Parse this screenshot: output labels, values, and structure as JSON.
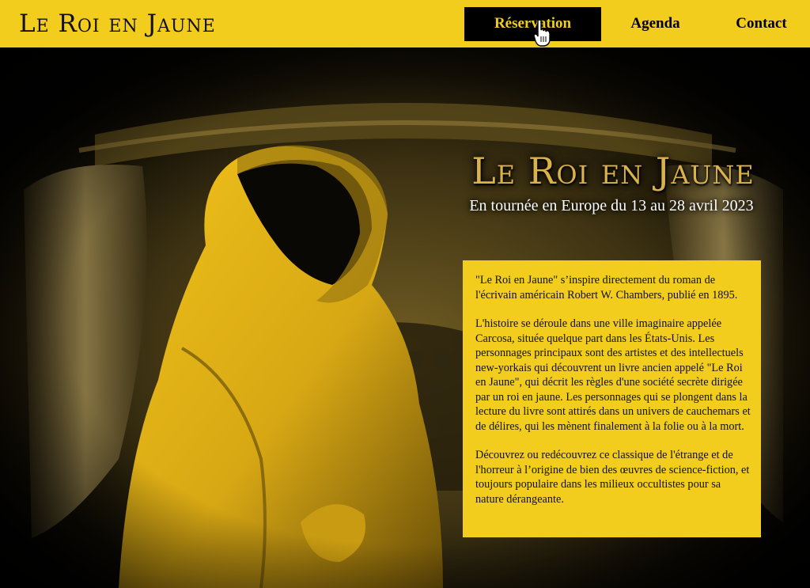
{
  "header": {
    "logo": "Le Roi en Jaune",
    "nav": [
      {
        "label": "Réservation"
      },
      {
        "label": "Agenda"
      },
      {
        "label": "Contact"
      }
    ]
  },
  "hero": {
    "title": "Le Roi en Jaune",
    "subtitle": "En tournée en Europe du 13 au 28 avril 2023",
    "paragraphs": [
      "\"Le Roi en Jaune\" s’inspire directement du roman de l'écrivain américain Robert W. Chambers, publié en 1895.",
      "L'histoire se déroule dans une ville imaginaire appelée Carcosa, située quelque part dans les États-Unis. Les personnages principaux sont des artistes et des intellectuels new-yorkais qui découvrent un livre ancien appelé \"Le Roi en Jaune\", qui décrit les règles d'une société secrète dirigée par un roi en jaune. Les personnages qui se plongent dans la lecture du livre sont attirés dans un univers de cauchemars et de délires, qui les mènent finalement à la folie ou à la mort.",
      "Découvrez ou redécouvrez ce classique de l'étrange et de l'horreur à l’origine de bien des œuvres de science-fiction, et toujours populaire dans les milieux occultistes pour sa nature dérangeante."
    ]
  },
  "colors": {
    "brand_yellow": "#f2cd1e",
    "dark": "#000000",
    "title_gold": "#d9b24a"
  },
  "icons": {
    "cursor": "hand-pointer-icon"
  }
}
